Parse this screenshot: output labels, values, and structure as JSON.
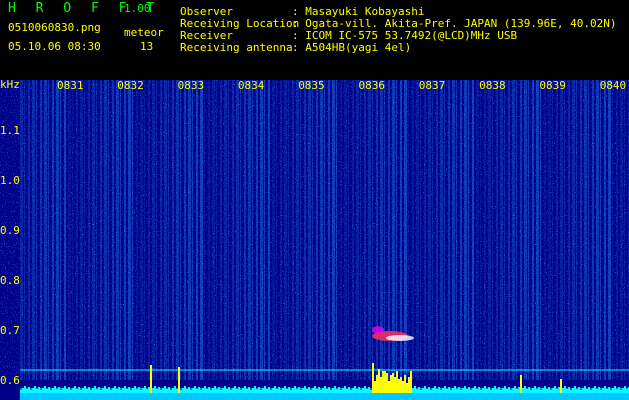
{
  "app": {
    "title": "H R O F F T",
    "version": "1.00"
  },
  "file": {
    "name": "0510060830.png",
    "date": "05.10.06 08:30"
  },
  "meteor": {
    "label": "meteor",
    "count": "13"
  },
  "info": {
    "observer_label": "Observer",
    "observer_value": ": Masayuki Kobayashi",
    "location_label": "Receiving Location",
    "location_value": ": Ogata-vill. Akita-Pref. JAPAN (139.96E, 40.02N)",
    "receiver_label": "Receiver",
    "receiver_value": ": ICOM IC-575 53.7492(@LCD)MHz USB",
    "antenna_label": "Receiving antenna",
    "antenna_value": ": A504HB(yagi 4el)"
  },
  "colors": {
    "yellow": "#ffff00",
    "green": "#00ff00",
    "cyan": "#00ffff",
    "background": "#00008a"
  },
  "spectrogram": {
    "ylabel": "kHz",
    "time_ticks": [
      "0831",
      "0832",
      "0833",
      "0834",
      "0835",
      "0836",
      "0837",
      "0838",
      "0839",
      "0840"
    ],
    "freq_ticks": [
      "1.1",
      "1.0",
      "0.9",
      "0.8",
      "0.7",
      "0.6"
    ]
  }
}
